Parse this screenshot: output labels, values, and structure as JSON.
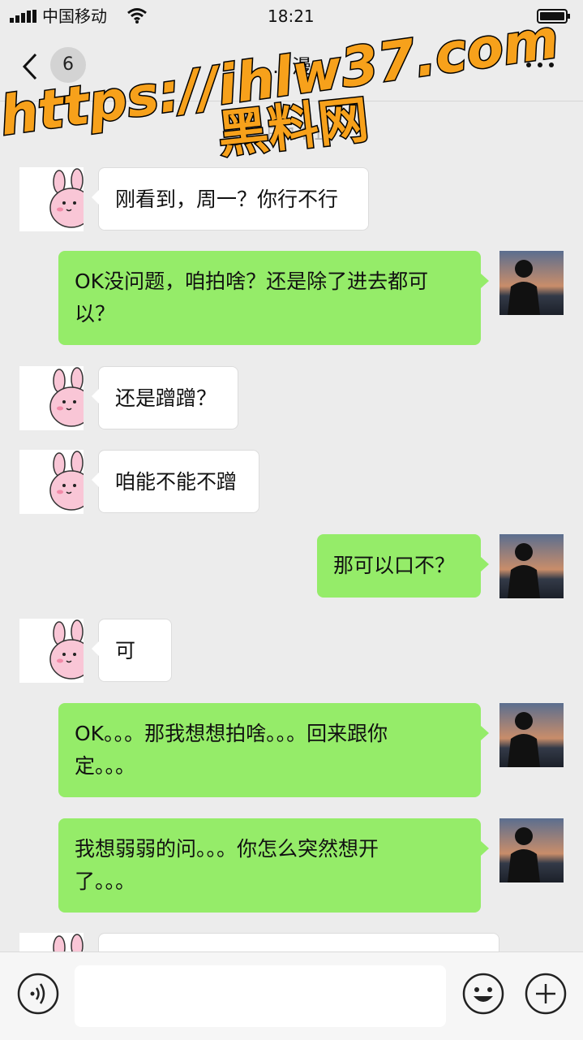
{
  "status_bar": {
    "carrier": "中国移动",
    "time": "18:21",
    "icons": [
      "signal-icon",
      "wifi-icon",
      "battery-icon"
    ]
  },
  "nav": {
    "unread_count": "6",
    "title": "…漫",
    "icons": [
      "chevron-left-icon",
      "more-icon"
    ]
  },
  "chat": {
    "timestamp": "…日 14:15",
    "messages": [
      {
        "from": "contact",
        "text_lines": [
          "刚看到，周一？你行不行"
        ]
      },
      {
        "from": "me",
        "text_lines": [
          "OK没问题，咱拍啥？还是除了进去都可",
          "以？"
        ]
      },
      {
        "from": "contact",
        "text_lines": [
          "还是蹭蹭？"
        ]
      },
      {
        "from": "contact",
        "text_lines": [
          "咱能不能不蹭"
        ]
      },
      {
        "from": "me",
        "text_lines": [
          "那可以口不？"
        ]
      },
      {
        "from": "contact",
        "text_lines": [
          "可"
        ]
      },
      {
        "from": "me",
        "text_lines": [
          "OK。。。那我想想拍啥。。。回来跟你",
          "定。。。"
        ]
      },
      {
        "from": "me",
        "text_lines": [
          "我想弱弱的问。。。你怎么突然想开",
          "了。。。"
        ]
      },
      {
        "from": "contact",
        "text_lines": [
          ""
        ]
      }
    ]
  },
  "input_bar": {
    "text_value": "",
    "icons": [
      "voice-icon",
      "emoji-icon",
      "plus-icon"
    ]
  },
  "watermark": {
    "line1": "https://ihlw37.com",
    "line2": "黑料网"
  },
  "colors": {
    "background": "#ececec",
    "my_bubble": "#95ec69",
    "contact_bubble": "#ffffff",
    "watermark_fill": "#f7a11b",
    "watermark_outline": "#000000"
  }
}
